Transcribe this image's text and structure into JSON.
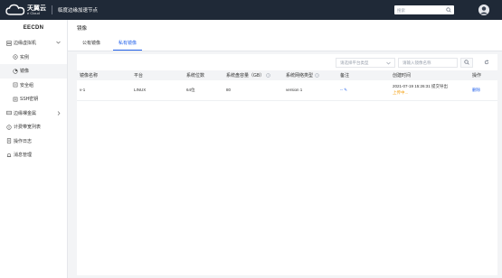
{
  "topbar": {
    "logo_cn": "天翼云",
    "logo_en": "e Cloud",
    "title": "临度边缘加速节点",
    "search_placeholder": "搜索"
  },
  "sidebar": {
    "brand": "EECDN",
    "items": [
      {
        "label": "边缘虚拟机",
        "icon": "server-icon",
        "expandable": true
      },
      {
        "label": "实例",
        "icon": "instance-icon",
        "sub": true
      },
      {
        "label": "镜像",
        "icon": "image-icon",
        "sub": true,
        "active": true
      },
      {
        "label": "安全组",
        "icon": "shield-icon",
        "sub": true
      },
      {
        "label": "SSH密钥",
        "icon": "key-icon",
        "sub": true
      },
      {
        "label": "边缘裸金属",
        "icon": "bare-metal-icon",
        "expandable": true
      },
      {
        "label": "计费带宽列表",
        "icon": "billing-icon"
      },
      {
        "label": "操作日志",
        "icon": "log-icon"
      },
      {
        "label": "消息管理",
        "icon": "message-icon"
      }
    ]
  },
  "page": {
    "title": "镜像",
    "tabs": [
      {
        "label": "公有镜像"
      },
      {
        "label": "私有镜像",
        "active": true
      }
    ]
  },
  "filters": {
    "platform_placeholder": "请选择平台类型",
    "name_placeholder": "请输入镜像名称"
  },
  "table": {
    "headers": [
      "镜像名称",
      "平台",
      "系统位数",
      "系统盘容量（GB）",
      "系统网络类型",
      "备注",
      "创建时间",
      "操作"
    ],
    "rows": [
      {
        "name": "v-1",
        "platform": "LINUX",
        "bits": "64位",
        "disk": "80",
        "network": "version 1",
        "note": "-- ✎",
        "created": "2021-07-19 15:26:31 提交导出",
        "status": "上传中...",
        "action": "删除"
      }
    ]
  },
  "colors": {
    "topbar": "#1f2937",
    "accent": "#2563eb",
    "status": "#f59e0b"
  }
}
